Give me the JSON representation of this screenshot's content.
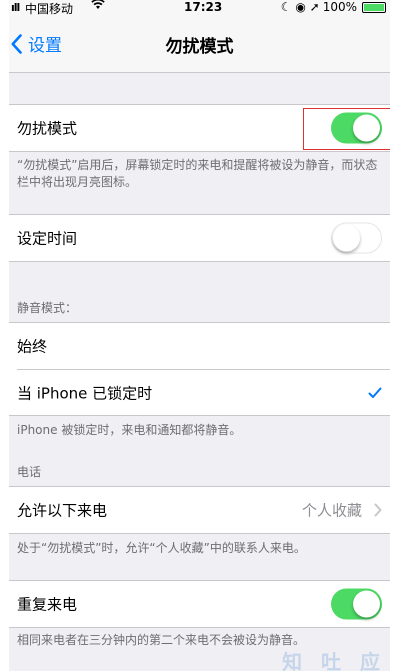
{
  "status_bar": {
    "signal": "ıll",
    "carrier": "中国移动",
    "wifi_icon": "wifi-icon",
    "time": "17:23",
    "icons_right": "☾ ◉ ➚",
    "battery_percent": "100%",
    "battery_level": 1.0
  },
  "nav": {
    "back_label": "设置",
    "title": "勿扰模式"
  },
  "dnd": {
    "label": "勿扰模式",
    "toggle_on": true,
    "note": "“勿扰模式”启用后，屏幕锁定时的来电和提醒将被设为静音，而状态栏中将出现月亮图标。"
  },
  "scheduled": {
    "label": "设定时间",
    "toggle_on": false
  },
  "silence": {
    "header": "静音模式：",
    "always_label": "始终",
    "locked_label": "当 iPhone 已锁定时",
    "locked_checked": true,
    "note": "iPhone 被锁定时，来电和通知都将静音。"
  },
  "phone": {
    "header": "电话",
    "allow_calls_label": "允许以下来电",
    "allow_calls_value": "个人收藏",
    "note": "处于“勿扰模式”时，允许“个人收藏”中的联系人来电。",
    "repeated_label": "重复来电",
    "repeated_on": true,
    "repeated_note": "相同来电者在三分钟内的第二个来电不会被设为静音。"
  },
  "colors": {
    "accent": "#007aff",
    "toggle_on": "#4cd964",
    "highlight": "#e0302f"
  }
}
